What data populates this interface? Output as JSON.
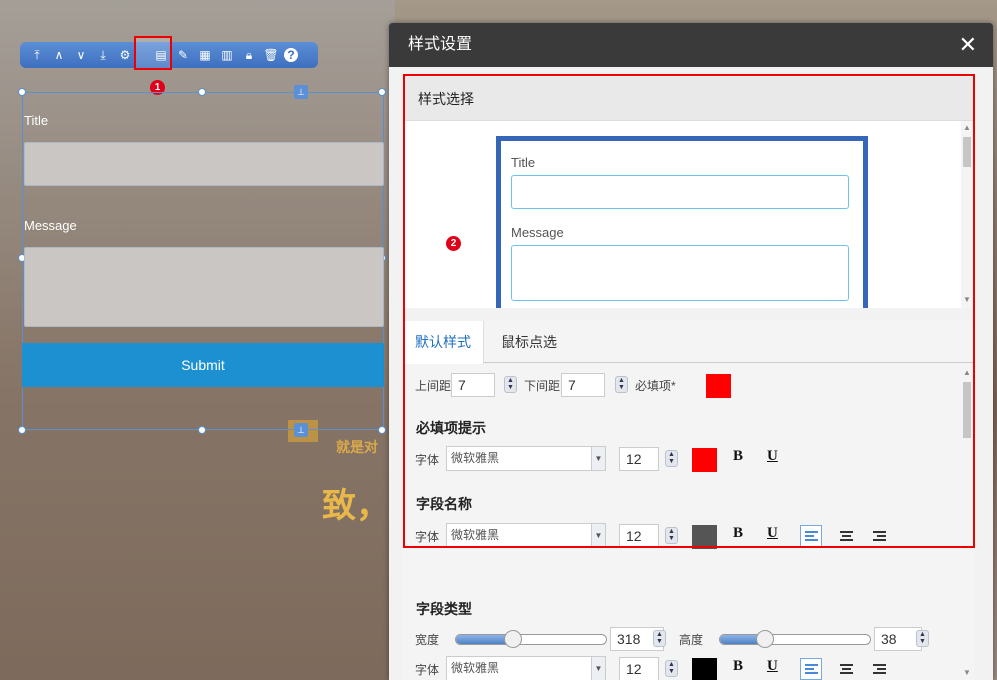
{
  "colors": {
    "accent": "#1e6fc2",
    "required_red": "#ff0000",
    "dark_gray": "#555555",
    "black": "#000000",
    "highlight_red": "#e00000"
  },
  "toolbar": {
    "icons": [
      "go-top-icon",
      "up-icon",
      "down-icon",
      "go-bottom-icon",
      "gear-icon",
      "style-settings-icon",
      "edit-icon",
      "grid-icon",
      "chart-icon",
      "lock-icon",
      "delete-icon",
      "help-icon"
    ],
    "badge": "1"
  },
  "form": {
    "title_label": "Title",
    "message_label": "Message",
    "submit_label": "Submit"
  },
  "background": {
    "text_small": "就是对",
    "text_large": "致，"
  },
  "dialog": {
    "title": "样式设置",
    "close": "✕",
    "style_select_header": "样式选择",
    "badge": "2",
    "preview": {
      "title_label": "Title",
      "message_label": "Message"
    },
    "tabs": [
      {
        "label": "默认样式"
      },
      {
        "label": "鼠标点选"
      }
    ],
    "spacing": {
      "top_label": "上间距",
      "top_value": "7",
      "bottom_label": "下间距",
      "bottom_value": "7",
      "required_label": "必填项*"
    },
    "required_hint": {
      "title": "必填项提示",
      "font_label": "字体",
      "font_value": "微软雅黑",
      "size": "12",
      "bold": "B",
      "underline": "U"
    },
    "field_name": {
      "title": "字段名称",
      "font_label": "字体",
      "font_value": "微软雅黑",
      "size": "12",
      "bold": "B",
      "underline": "U"
    },
    "field_type": {
      "title": "字段类型",
      "width_label": "宽度",
      "width_value": "318",
      "height_label": "高度",
      "height_value": "38",
      "font_label": "字体",
      "font_value": "微软雅黑",
      "size": "12",
      "bold": "B",
      "underline": "U"
    }
  }
}
